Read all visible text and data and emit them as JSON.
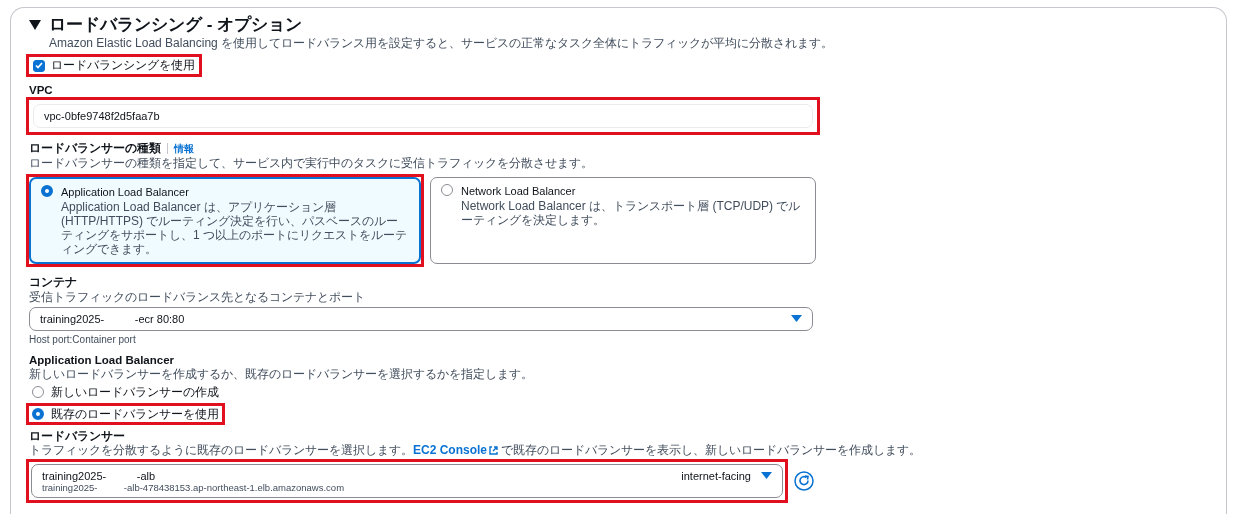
{
  "section": {
    "title": "ロードバランシング - オプション",
    "expanded": true,
    "description": "Amazon Elastic Load Balancing を使用してロードバランス用を設定すると、サービスの正常なタスク全体にトラフィックが平均に分散されます。"
  },
  "use_load_balancing": {
    "label": "ロードバランシングを使用",
    "checked": true,
    "highlighted": true
  },
  "vpc": {
    "label": "VPC",
    "value": "vpc-0bfe9748f2d5faa7b",
    "highlighted": true
  },
  "load_balancer_type": {
    "label": "ロードバランサーの種類",
    "info_link": "情報",
    "description": "ロードバランサーの種類を指定して、サービス内で実行中のタスクに受信トラフィックを分散させます。",
    "options": [
      {
        "title": "Application Load Balancer",
        "description": "Application Load Balancer は、アプリケーション層 (HTTP/HTTPS) でルーティング決定を行い、パスベースのルーティングをサポートし、1 つ以上のポートにリクエストをルーティングできます。",
        "selected": true,
        "highlighted": true
      },
      {
        "title": "Network Load Balancer",
        "description": "Network Load Balancer は、トランスポート層 (TCP/UDP) でルーティングを決定します。",
        "selected": false,
        "highlighted": false
      }
    ]
  },
  "container": {
    "label": "コンテナ",
    "description": "受信トラフィックのロードバランス先となるコンテナとポート",
    "value": "training2025-          -ecr 80:80",
    "hint": "Host port:Container port"
  },
  "application_load_balancer": {
    "label": "Application Load Balancer",
    "description": "新しいロードバランサーを作成するか、既存のロードバランサーを選択するかを指定します。",
    "options": [
      {
        "label": "新しいロードバランサーの作成",
        "selected": false,
        "highlighted": false
      },
      {
        "label": "既存のロードバランサーを使用",
        "selected": true,
        "highlighted": true
      }
    ]
  },
  "load_balancer": {
    "label": "ロードバランサー",
    "description_before": "トラフィックを分散するように既存のロードバランサーを選択します。",
    "link": "EC2 Console",
    "description_after": " で既存のロードバランサーを表示し、新しいロードバランサーを作成します。",
    "value": "training2025-          -alb",
    "detail": "training2025-          -alb-478438153.ap-northeast-1.elb.amazonaws.com",
    "scheme": "internet-facing",
    "highlighted": true
  }
}
